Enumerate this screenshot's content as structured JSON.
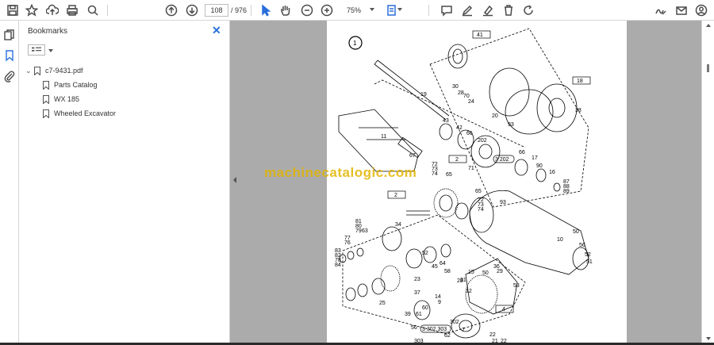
{
  "toolbar": {
    "page_current": "108",
    "page_total": "/ 976",
    "zoom": "75%",
    "icons": [
      "save-icon",
      "bookmark-star-icon",
      "upload-icon",
      "print-icon",
      "search-zoom-icon",
      "page-up-icon",
      "page-down-icon",
      "select-cursor-icon",
      "hand-icon",
      "zoom-out-icon",
      "zoom-in-icon",
      "page-fit-icon",
      "comment-icon",
      "pen-icon",
      "highlight-eraser-icon",
      "trash-icon",
      "rotate-icon",
      "sign-icon",
      "email-icon",
      "account-icon"
    ]
  },
  "bookmarks": {
    "title": "Bookmarks",
    "items": [
      {
        "label": "c7-9431.pdf",
        "level": 0,
        "expanded": true
      },
      {
        "label": "Parts Catalog",
        "level": 1
      },
      {
        "label": "WX 185",
        "level": 1
      },
      {
        "label": "Wheeled Excavator",
        "level": 1
      }
    ]
  },
  "document": {
    "watermark": "machinecatalogic.com",
    "callout_circle": "1",
    "boxed_refs": [
      "41",
      "18",
      "2",
      "2",
      "4",
      "3 202",
      "3 302.303"
    ],
    "part_numbers": [
      "30",
      "28",
      "70",
      "24",
      "20",
      "19",
      "93",
      "38",
      "43",
      "42",
      "66",
      "202",
      "11",
      "67",
      "71",
      "66",
      "17",
      "90",
      "16",
      "87",
      "88",
      "89",
      "72",
      "73",
      "74",
      "65",
      "65",
      "72",
      "73",
      "74",
      "93",
      "10",
      "50",
      "56",
      "52",
      "51",
      "81",
      "80",
      "79",
      "63",
      "77",
      "76",
      "34",
      "83",
      "82",
      "78",
      "84",
      "52",
      "64",
      "29",
      "45",
      "58",
      "23",
      "15",
      "50",
      "31",
      "53",
      "36",
      "37",
      "28",
      "12",
      "25",
      "14",
      "9",
      "60",
      "61",
      "302",
      "62",
      "39",
      "7",
      "56",
      "303",
      "21",
      "22",
      "22"
    ]
  },
  "colors": {
    "accent": "#2a6fdb",
    "watermark": "#e2b400",
    "doc_background": "#ababab"
  }
}
